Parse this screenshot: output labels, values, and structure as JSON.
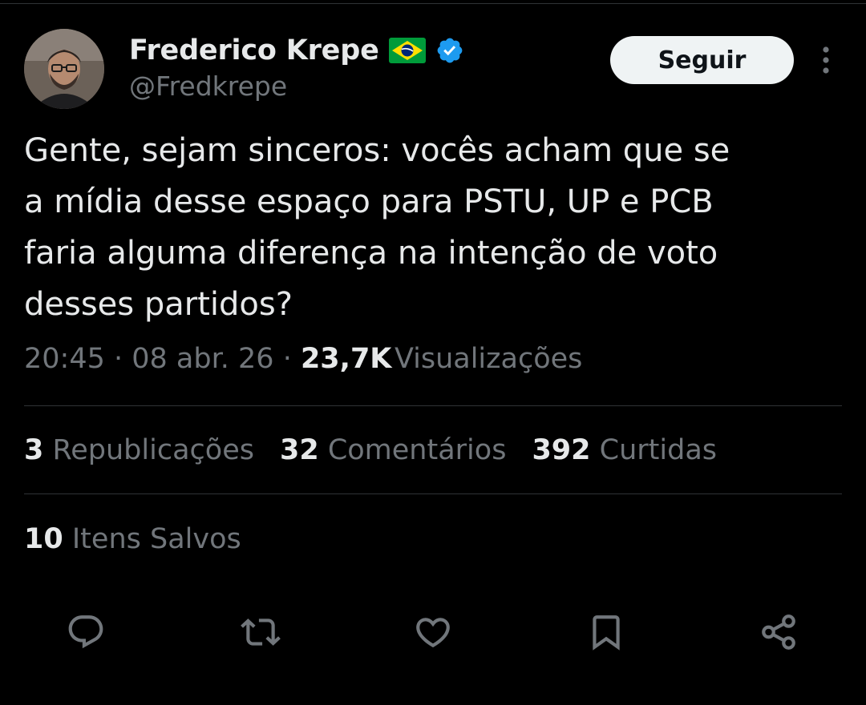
{
  "author": {
    "display_name": "Frederico Krepe",
    "handle": "@Fredkrepe",
    "flag_icon": "brazil-flag-emoji",
    "verified_icon": "verified-badge-icon",
    "verified_color": "#1d9bf0"
  },
  "follow_button": {
    "label": "Seguir"
  },
  "tweet": {
    "text": "Gente, sejam sinceros: vocês acham que se\na mídia desse espaço para PSTU, UP e PCB\nfaria alguma diferença na intenção de voto\ndesses partidos?",
    "time": "20:45",
    "separator": " · ",
    "date": "08 abr. 26",
    "views_count": "23,7K",
    "views_label": "Visualizações"
  },
  "stats": {
    "reposts_count": "3",
    "reposts_label": "Republicações",
    "comments_count": "32",
    "comments_label": "Comentários",
    "likes_count": "392",
    "likes_label": "Curtidas",
    "saved_count": "10",
    "saved_label": "Itens Salvos"
  },
  "actions": {
    "icons": [
      "reply-icon",
      "repost-icon",
      "like-icon",
      "bookmark-icon",
      "share-icon"
    ]
  },
  "colors": {
    "background": "#000000",
    "primary_text": "#e7e9ea",
    "secondary_text": "#71767b",
    "divider": "#2f3336",
    "follow_button_bg": "#eff3f4"
  }
}
